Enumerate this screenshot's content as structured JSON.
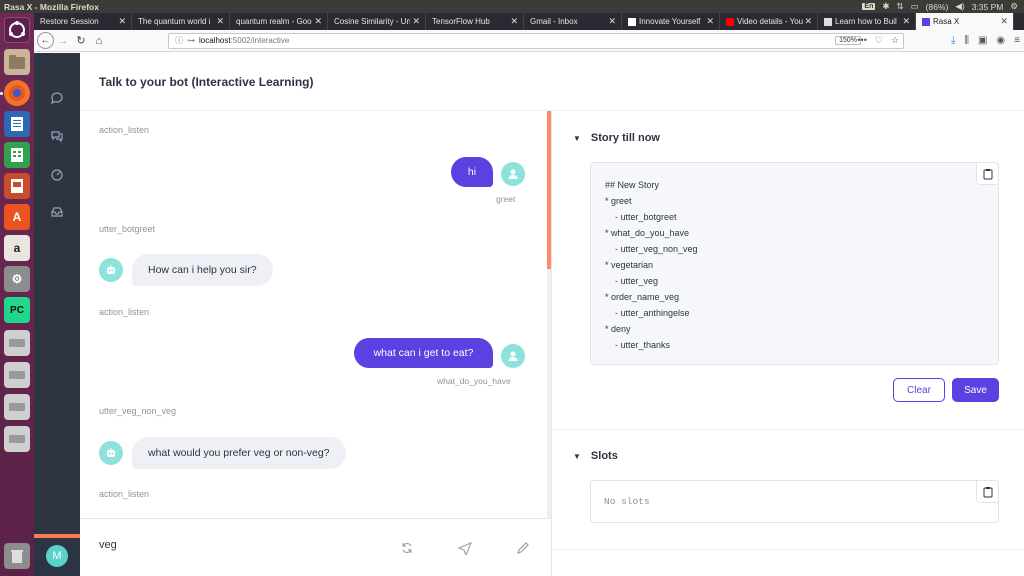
{
  "os": {
    "window_title": "Rasa X - Mozilla Firefox",
    "keyboard": "En",
    "battery": "(86%)",
    "time": "3:35 PM"
  },
  "browser": {
    "tabs": [
      {
        "label": "Restore Session",
        "active": false
      },
      {
        "label": "The quantum world i",
        "active": false
      },
      {
        "label": "quantum realm - Goo",
        "active": false
      },
      {
        "label": "Cosine Similarity - Un",
        "active": false
      },
      {
        "label": "TensorFlow Hub",
        "active": false
      },
      {
        "label": "Gmail - Inbox",
        "active": false
      },
      {
        "label": "Innovate Yourself",
        "active": false
      },
      {
        "label": "Video details - You",
        "active": false
      },
      {
        "label": "Learn how to Buil",
        "active": false
      },
      {
        "label": "Rasa X",
        "active": true
      }
    ],
    "url_host": "localhost",
    "url_path": ":5002/interactive",
    "zoom": "150%"
  },
  "app": {
    "page_title": "Talk to your bot (Interactive Learning)",
    "avatar_initial": "M",
    "chat": {
      "action_1": "action_listen",
      "user_msg_1": "hi",
      "intent_1": "greet",
      "action_2": "utter_botgreet",
      "bot_msg_1": "How can i help you sir?",
      "action_3": "action_listen",
      "user_msg_2": "what can i get to eat?",
      "intent_2": "what_do_you_have",
      "action_4": "utter_veg_non_veg",
      "bot_msg_2": "what would you prefer veg or non-veg?",
      "action_5": "action_listen"
    },
    "composer": {
      "input_value": "veg"
    },
    "story": {
      "heading": "Story till now",
      "lines": [
        "## New Story",
        "* greet",
        "    - utter_botgreet",
        "* what_do_you_have",
        "    - utter_veg_non_veg",
        "* vegetarian",
        "    - utter_veg",
        "* order_name_veg",
        "    - utter_anthingelse",
        "* deny",
        "    - utter_thanks"
      ],
      "clear_label": "Clear",
      "save_label": "Save"
    },
    "slots": {
      "heading": "Slots",
      "empty_text": "No slots"
    }
  },
  "colors": {
    "accent": "#5a41e0",
    "nav_bg": "#2d3442",
    "avatar_teal": "#8ee2dc",
    "scroll_orange": "#ff8c61"
  },
  "icons": {
    "nav": [
      "chat-bubble-icon",
      "conversations-icon",
      "dashboard-icon",
      "inbox-icon"
    ],
    "composer": [
      "restart-icon",
      "send-icon",
      "pencil-icon"
    ]
  }
}
